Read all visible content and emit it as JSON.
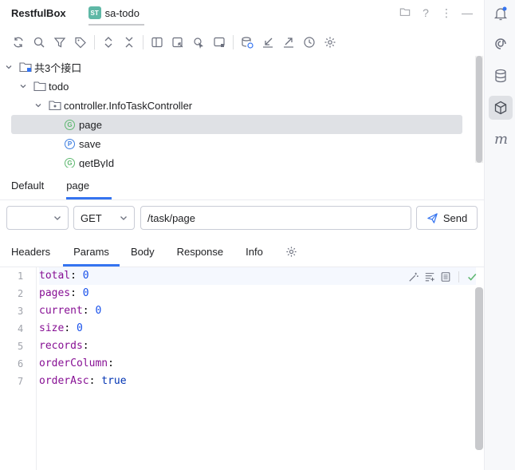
{
  "titlebar": {
    "app_title": "RestfulBox",
    "tab_badge": "ST",
    "tab_label": "sa-todo"
  },
  "tree": {
    "root_label": "共3个接口",
    "module_label": "todo",
    "controller_label": "controller.InfoTaskController",
    "endpoints": [
      {
        "badge": "G",
        "label": "page",
        "selected": true
      },
      {
        "badge": "P",
        "label": "save",
        "selected": false
      },
      {
        "badge": "G",
        "label": "getById",
        "selected": false
      }
    ]
  },
  "env_tabs": [
    {
      "label": "Default",
      "active": false
    },
    {
      "label": "page",
      "active": true
    }
  ],
  "request": {
    "env_value": "",
    "method": "GET",
    "url": "/task/page",
    "send_label": "Send"
  },
  "req_tabs": [
    {
      "label": "Headers",
      "active": false
    },
    {
      "label": "Params",
      "active": true
    },
    {
      "label": "Body",
      "active": false
    },
    {
      "label": "Response",
      "active": false
    },
    {
      "label": "Info",
      "active": false
    }
  ],
  "editor": {
    "line_numbers": [
      "1",
      "2",
      "3",
      "4",
      "5",
      "6",
      "7"
    ],
    "lines": [
      {
        "key": "total",
        "sep": ": ",
        "value": "0"
      },
      {
        "key": "pages",
        "sep": ": ",
        "value": "0"
      },
      {
        "key": "current",
        "sep": ": ",
        "value": "0"
      },
      {
        "key": "size",
        "sep": ": ",
        "value": "0"
      },
      {
        "key": "records",
        "sep": ":",
        "value": ""
      },
      {
        "key": "orderColumn",
        "sep": ":",
        "value": ""
      },
      {
        "key": "orderAsc",
        "sep": ": ",
        "value": "true"
      }
    ]
  },
  "colors": {
    "accent": "#3574f0",
    "selected_row": "#dfe1e5",
    "get_badge": "#5fb871",
    "post_badge": "#3d7ee0"
  }
}
